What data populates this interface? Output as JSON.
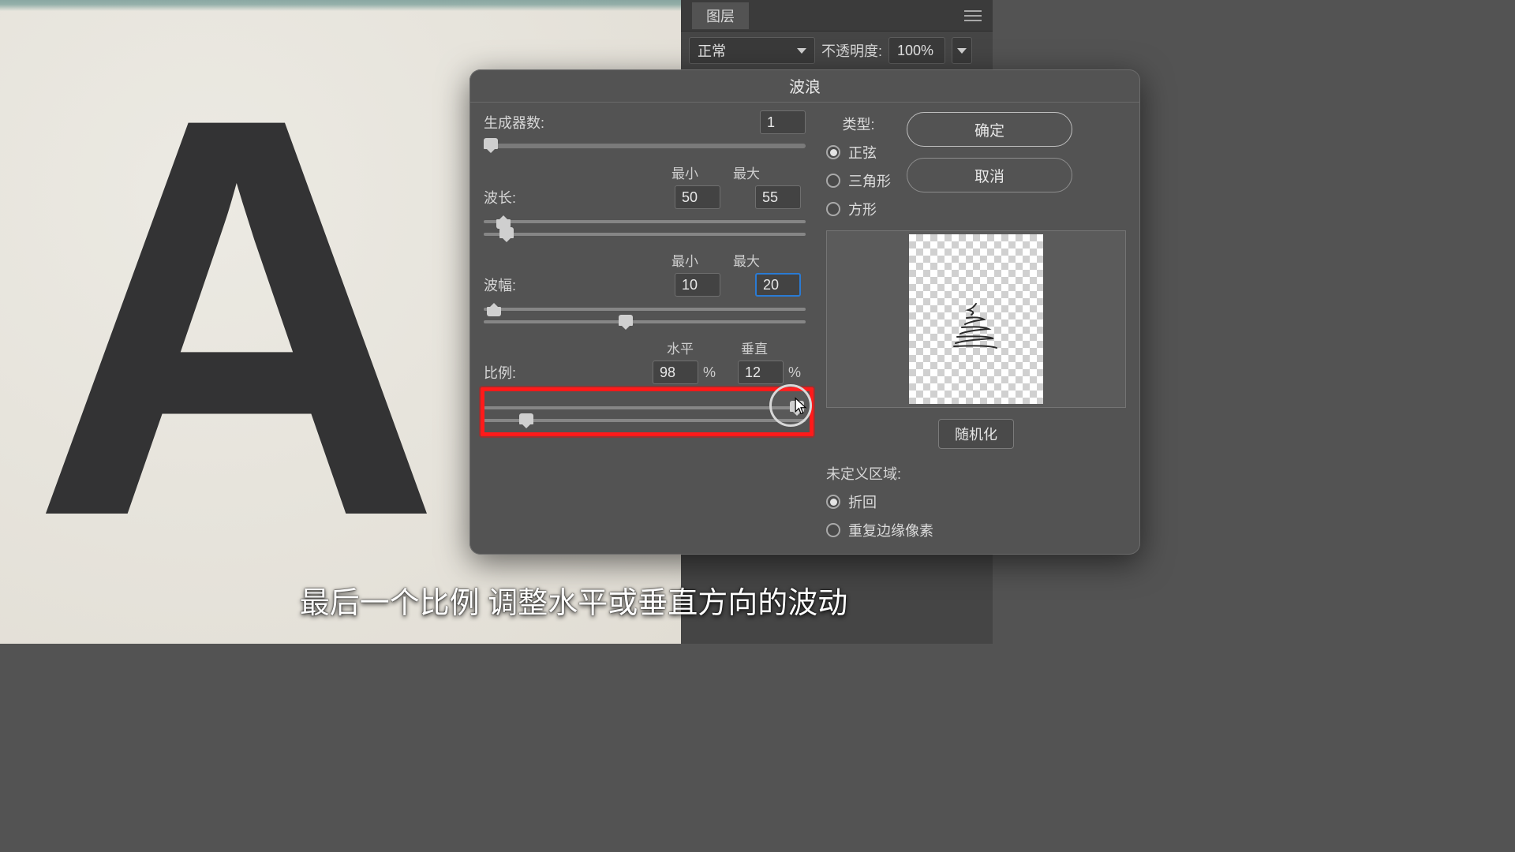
{
  "layers_panel": {
    "title": "图层",
    "blend_mode": "正常",
    "opacity_label": "不透明度:",
    "opacity_value": "100%"
  },
  "canvas": {
    "letter": "A"
  },
  "dialog": {
    "title": "波浪",
    "generators": {
      "label": "生成器数:",
      "value": "1"
    },
    "wavelength": {
      "label": "波长:",
      "min_label": "最小",
      "max_label": "最大",
      "min": "50",
      "max": "55"
    },
    "amplitude": {
      "label": "波幅:",
      "min_label": "最小",
      "max_label": "最大",
      "min": "10",
      "max": "20"
    },
    "scale": {
      "label": "比例:",
      "h_label": "水平",
      "v_label": "垂直",
      "h": "98",
      "v": "12",
      "pct": "%"
    },
    "type": {
      "title": "类型:",
      "sine": "正弦",
      "triangle": "三角形",
      "square": "方形",
      "selected": "sine"
    },
    "buttons": {
      "ok": "确定",
      "cancel": "取消",
      "randomize": "随机化"
    },
    "undefined_area": {
      "title": "未定义区域:",
      "wrap": "折回",
      "repeat": "重复边缘像素",
      "selected": "wrap"
    }
  },
  "subtitle": "最后一个比例 调整水平或垂直方向的波动"
}
